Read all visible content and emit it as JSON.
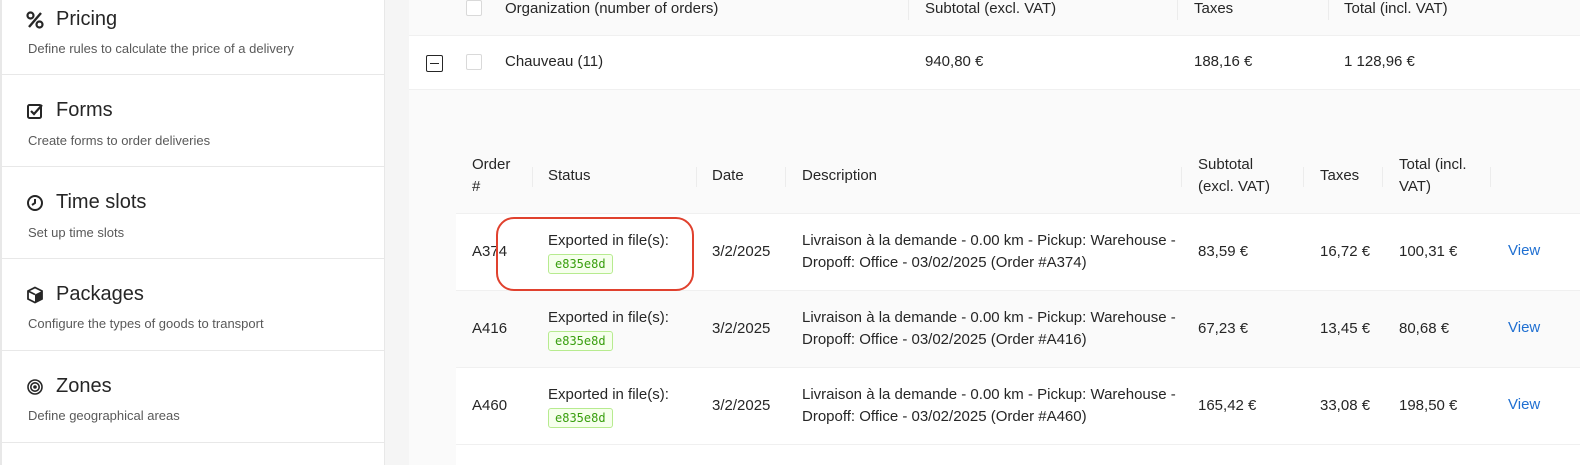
{
  "sidebar": {
    "items": [
      {
        "icon": "percent-icon",
        "title": "Pricing",
        "description": "Define rules to calculate the price of a delivery"
      },
      {
        "icon": "check-square-icon",
        "title": "Forms",
        "description": "Create forms to order deliveries"
      },
      {
        "icon": "clock-icon",
        "title": "Time slots",
        "description": "Set up time slots"
      },
      {
        "icon": "package-icon",
        "title": "Packages",
        "description": "Configure the types of goods to transport"
      },
      {
        "icon": "target-icon",
        "title": "Zones",
        "description": "Define geographical areas"
      }
    ]
  },
  "outer_table": {
    "headers": {
      "organization": "Organization (number of orders)",
      "subtotal": "Subtotal (excl. VAT)",
      "taxes": "Taxes",
      "total": "Total (incl. VAT)"
    },
    "rows": [
      {
        "organization": "Chauveau (11)",
        "subtotal": "940,80 €",
        "taxes": "188,16 €",
        "total": "1 128,96 €"
      }
    ]
  },
  "inner_table": {
    "headers": {
      "order_line1": "Order",
      "order_line2": "#",
      "status": "Status",
      "date": "Date",
      "description": "Description",
      "subtotal_line1": "Subtotal",
      "subtotal_line2": "(excl. VAT)",
      "taxes": "Taxes",
      "total_line1": "Total (incl.",
      "total_line2": "VAT)"
    },
    "rows": [
      {
        "order": "A374",
        "status": "Exported in file(s):",
        "file_tag": "e835e8d",
        "date": "3/2/2025",
        "description_line1": "Livraison à la demande - 0.00 km - Pickup: Warehouse -",
        "description_line2": "Dropoff: Office - 03/02/2025 (Order #A374)",
        "subtotal": "83,59 €",
        "taxes": "16,72 €",
        "total": "100,31 €",
        "action": "View"
      },
      {
        "order": "A416",
        "status": "Exported in file(s):",
        "file_tag": "e835e8d",
        "date": "3/2/2025",
        "description_line1": "Livraison à la demande - 0.00 km - Pickup: Warehouse -",
        "description_line2": "Dropoff: Office - 03/02/2025 (Order #A416)",
        "subtotal": "67,23 €",
        "taxes": "13,45 €",
        "total": "80,68 €",
        "action": "View"
      },
      {
        "order": "A460",
        "status": "Exported in file(s):",
        "file_tag": "e835e8d",
        "date": "3/2/2025",
        "description_line1": "Livraison à la demande - 0.00 km - Pickup: Warehouse -",
        "description_line2": "Dropoff: Office - 03/02/2025 (Order #A460)",
        "subtotal": "165,42 €",
        "taxes": "33,08 €",
        "total": "198,50 €",
        "action": "View"
      }
    ]
  },
  "colors": {
    "link": "#1f6fd1",
    "highlight": "#e0412e",
    "tag_text": "#389e0d"
  }
}
